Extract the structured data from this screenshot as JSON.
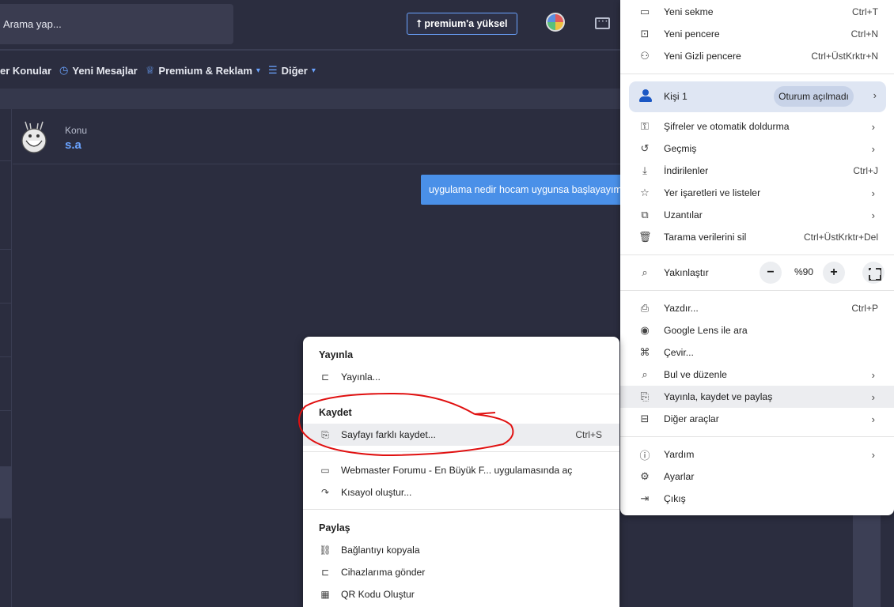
{
  "forum": {
    "search_placeholder": "Arama yap...",
    "premium_label": "premium'a yüksel",
    "nav": [
      {
        "icon": "new-topics-icon",
        "label": "er Konular"
      },
      {
        "icon": "clock-icon",
        "label": "Yeni Mesajlar"
      },
      {
        "icon": "award-icon",
        "label": "Premium & Reklam"
      },
      {
        "icon": "list-icon",
        "label": "Diğer"
      }
    ],
    "thread": {
      "konu_label": "Konu",
      "title": "s.a",
      "message": "uygulama nedir hocam uygunsa başlayayım"
    }
  },
  "browser_menu": {
    "items_top": [
      {
        "icon": "new-tab-icon",
        "label": "Yeni sekme",
        "shortcut": "Ctrl+T"
      },
      {
        "icon": "new-window-icon",
        "label": "Yeni pencere",
        "shortcut": "Ctrl+N"
      },
      {
        "icon": "incognito-icon",
        "label": "Yeni Gizli pencere",
        "shortcut": "Ctrl+ÜstKrktr+N"
      }
    ],
    "profile": {
      "label": "Kişi 1",
      "badge": "Oturum açılmadı"
    },
    "items_mid": [
      {
        "icon": "key-icon",
        "label": "Şifreler ve otomatik doldurma",
        "shortcut": "",
        "arrow": true
      },
      {
        "icon": "history-icon",
        "label": "Geçmiş",
        "shortcut": "",
        "arrow": true
      },
      {
        "icon": "download-icon",
        "label": "İndirilenler",
        "shortcut": "Ctrl+J",
        "arrow": false
      },
      {
        "icon": "star-icon",
        "label": "Yer işaretleri ve listeler",
        "shortcut": "",
        "arrow": true
      },
      {
        "icon": "extensions-icon",
        "label": "Uzantılar",
        "shortcut": "",
        "arrow": true
      },
      {
        "icon": "trash-icon",
        "label": "Tarama verilerini sil",
        "shortcut": "Ctrl+ÜstKrktr+Del",
        "arrow": false
      }
    ],
    "zoom": {
      "label": "Yakınlaştır",
      "value": "%90",
      "minus": "−",
      "plus": "+"
    },
    "items_tools": [
      {
        "icon": "print-icon",
        "label": "Yazdır...",
        "shortcut": "Ctrl+P",
        "arrow": false
      },
      {
        "icon": "lens-icon",
        "label": "Google Lens ile ara",
        "shortcut": "",
        "arrow": false
      },
      {
        "icon": "translate-icon",
        "label": "Çevir...",
        "shortcut": "",
        "arrow": false
      },
      {
        "icon": "find-icon",
        "label": "Bul ve düzenle",
        "shortcut": "",
        "arrow": true
      },
      {
        "icon": "cast-save-share-icon",
        "label": "Yayınla, kaydet ve paylaş",
        "shortcut": "",
        "arrow": true
      },
      {
        "icon": "toolbox-icon",
        "label": "Diğer araçlar",
        "shortcut": "",
        "arrow": true
      }
    ],
    "items_bottom": [
      {
        "icon": "help-icon",
        "label": "Yardım",
        "shortcut": "",
        "arrow": true
      },
      {
        "icon": "settings-icon",
        "label": "Ayarlar",
        "shortcut": "",
        "arrow": false
      },
      {
        "icon": "exit-icon",
        "label": "Çıkış",
        "shortcut": "",
        "arrow": false
      }
    ]
  },
  "submenu": {
    "cast_header": "Yayınla",
    "cast_item": "Yayınla...",
    "save_header": "Kaydet",
    "save_item": "Sayfayı farklı kaydet...",
    "save_shortcut": "Ctrl+S",
    "install_item": "Webmaster Forumu - En Büyük F... uygulamasında aç",
    "shortcut_item": "Kısayol oluştur...",
    "share_header": "Paylaş",
    "copy_link": "Bağlantıyı kopyala",
    "send_devices": "Cihazlarıma gönder",
    "qr_code": "QR Kodu Oluştur"
  },
  "colors": {
    "accent": "#6aa3ff",
    "annotation": "#e01010",
    "bubble": "#4a90e8"
  }
}
